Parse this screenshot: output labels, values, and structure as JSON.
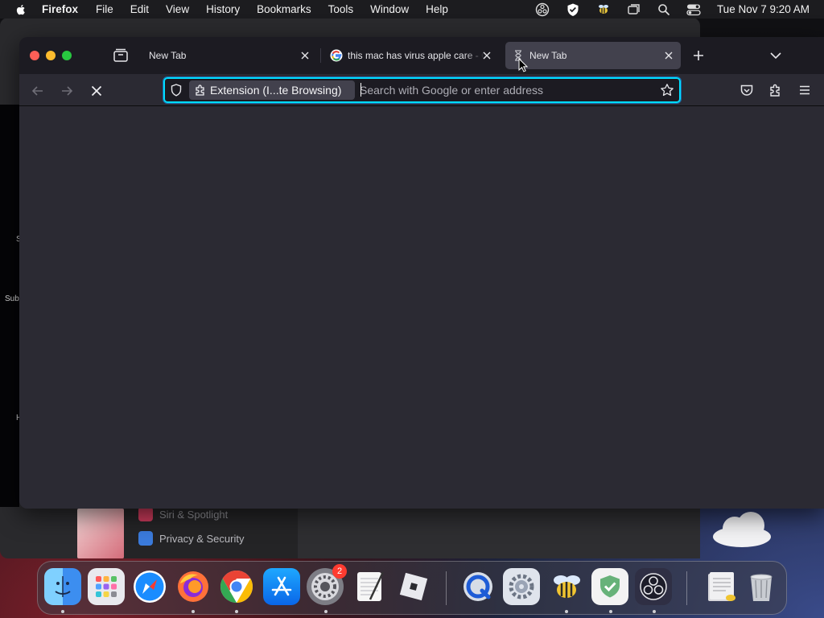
{
  "menubar": {
    "app_name": "Firefox",
    "items": [
      "File",
      "Edit",
      "View",
      "History",
      "Bookmarks",
      "Tools",
      "Window",
      "Help"
    ],
    "clock": "Tue Nov 7  9:20 AM"
  },
  "background": {
    "left_texts": [
      "S",
      "Sub",
      "H"
    ],
    "settings_items": [
      {
        "label": "Siri & Spotlight",
        "color": "#c93a5a"
      },
      {
        "label": "Privacy & Security",
        "color": "#3b7bdc"
      }
    ]
  },
  "browser": {
    "tabs": [
      {
        "title": "New Tab",
        "favicon": "none",
        "active": false
      },
      {
        "title": "this mac has virus apple care - Google Search",
        "favicon": "google-icon",
        "active": false
      },
      {
        "title": "New Tab",
        "favicon": "loading-hourglass-icon",
        "active": true
      }
    ],
    "urlbar": {
      "extension_chip": "Extension (I...te Browsing)",
      "placeholder": "Search with Google or enter address",
      "value": ""
    },
    "accent": "#00ddff"
  },
  "dock": {
    "apps": [
      {
        "name": "Finder",
        "icon": "finder-icon"
      },
      {
        "name": "Launchpad",
        "icon": "launchpad-icon"
      },
      {
        "name": "Safari",
        "icon": "safari-icon"
      },
      {
        "name": "Firefox",
        "icon": "firefox-icon"
      },
      {
        "name": "Google Chrome",
        "icon": "chrome-icon"
      },
      {
        "name": "App Store",
        "icon": "app-store-icon"
      },
      {
        "name": "System Settings",
        "icon": "system-settings-icon",
        "badge": "2"
      },
      {
        "name": "TextEdit",
        "icon": "textedit-icon"
      },
      {
        "name": "Roblox",
        "icon": "roblox-icon"
      },
      {
        "name": "QuickTime Player",
        "icon": "quicktime-icon"
      },
      {
        "name": "System Preferences",
        "icon": "preferences-gear-icon"
      },
      {
        "name": "Bee App",
        "icon": "bee-icon"
      },
      {
        "name": "AdGuard",
        "icon": "shield-check-icon"
      },
      {
        "name": "OBS Studio",
        "icon": "obs-icon"
      },
      {
        "name": "Documents",
        "icon": "documents-stack-icon"
      },
      {
        "name": "Trash",
        "icon": "trash-icon"
      }
    ]
  }
}
